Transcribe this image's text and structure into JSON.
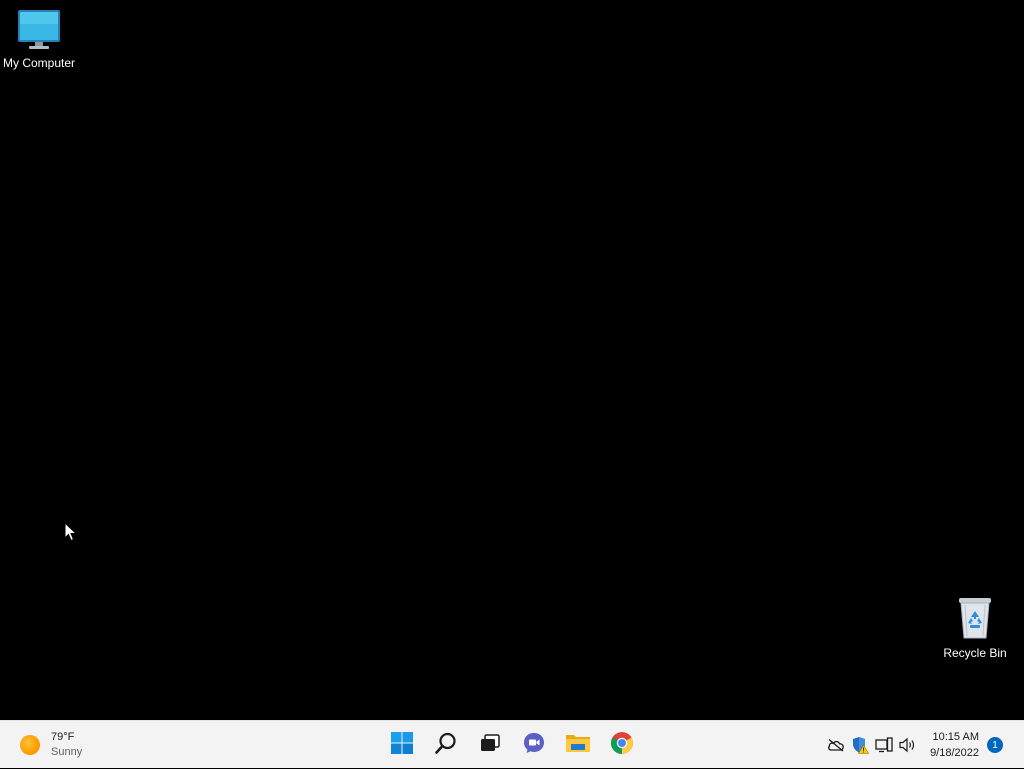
{
  "desktop": {
    "icons": [
      {
        "label": "My Computer",
        "icon": "computer-monitor-icon"
      },
      {
        "label": "Recycle Bin",
        "icon": "recycle-bin-icon"
      }
    ]
  },
  "taskbar": {
    "weather": {
      "temperature": "79°F",
      "condition": "Sunny",
      "icon": "sun-icon"
    },
    "apps": [
      {
        "name": "Start",
        "icon": "windows-start-icon"
      },
      {
        "name": "Search",
        "icon": "search-icon"
      },
      {
        "name": "Task View",
        "icon": "task-view-icon"
      },
      {
        "name": "Chat",
        "icon": "chat-icon"
      },
      {
        "name": "File Explorer",
        "icon": "folder-icon"
      },
      {
        "name": "Google Chrome",
        "icon": "chrome-icon"
      }
    ],
    "tray": {
      "icons": [
        "onedrive-offline-icon",
        "security-warning-icon",
        "network-icon",
        "volume-icon"
      ],
      "time": "10:15 AM",
      "date": "9/18/2022",
      "notification_count": "1"
    }
  },
  "colors": {
    "desktop_background": "#000000",
    "taskbar_background": "#f3f3f3",
    "accent": "#0067c0"
  }
}
